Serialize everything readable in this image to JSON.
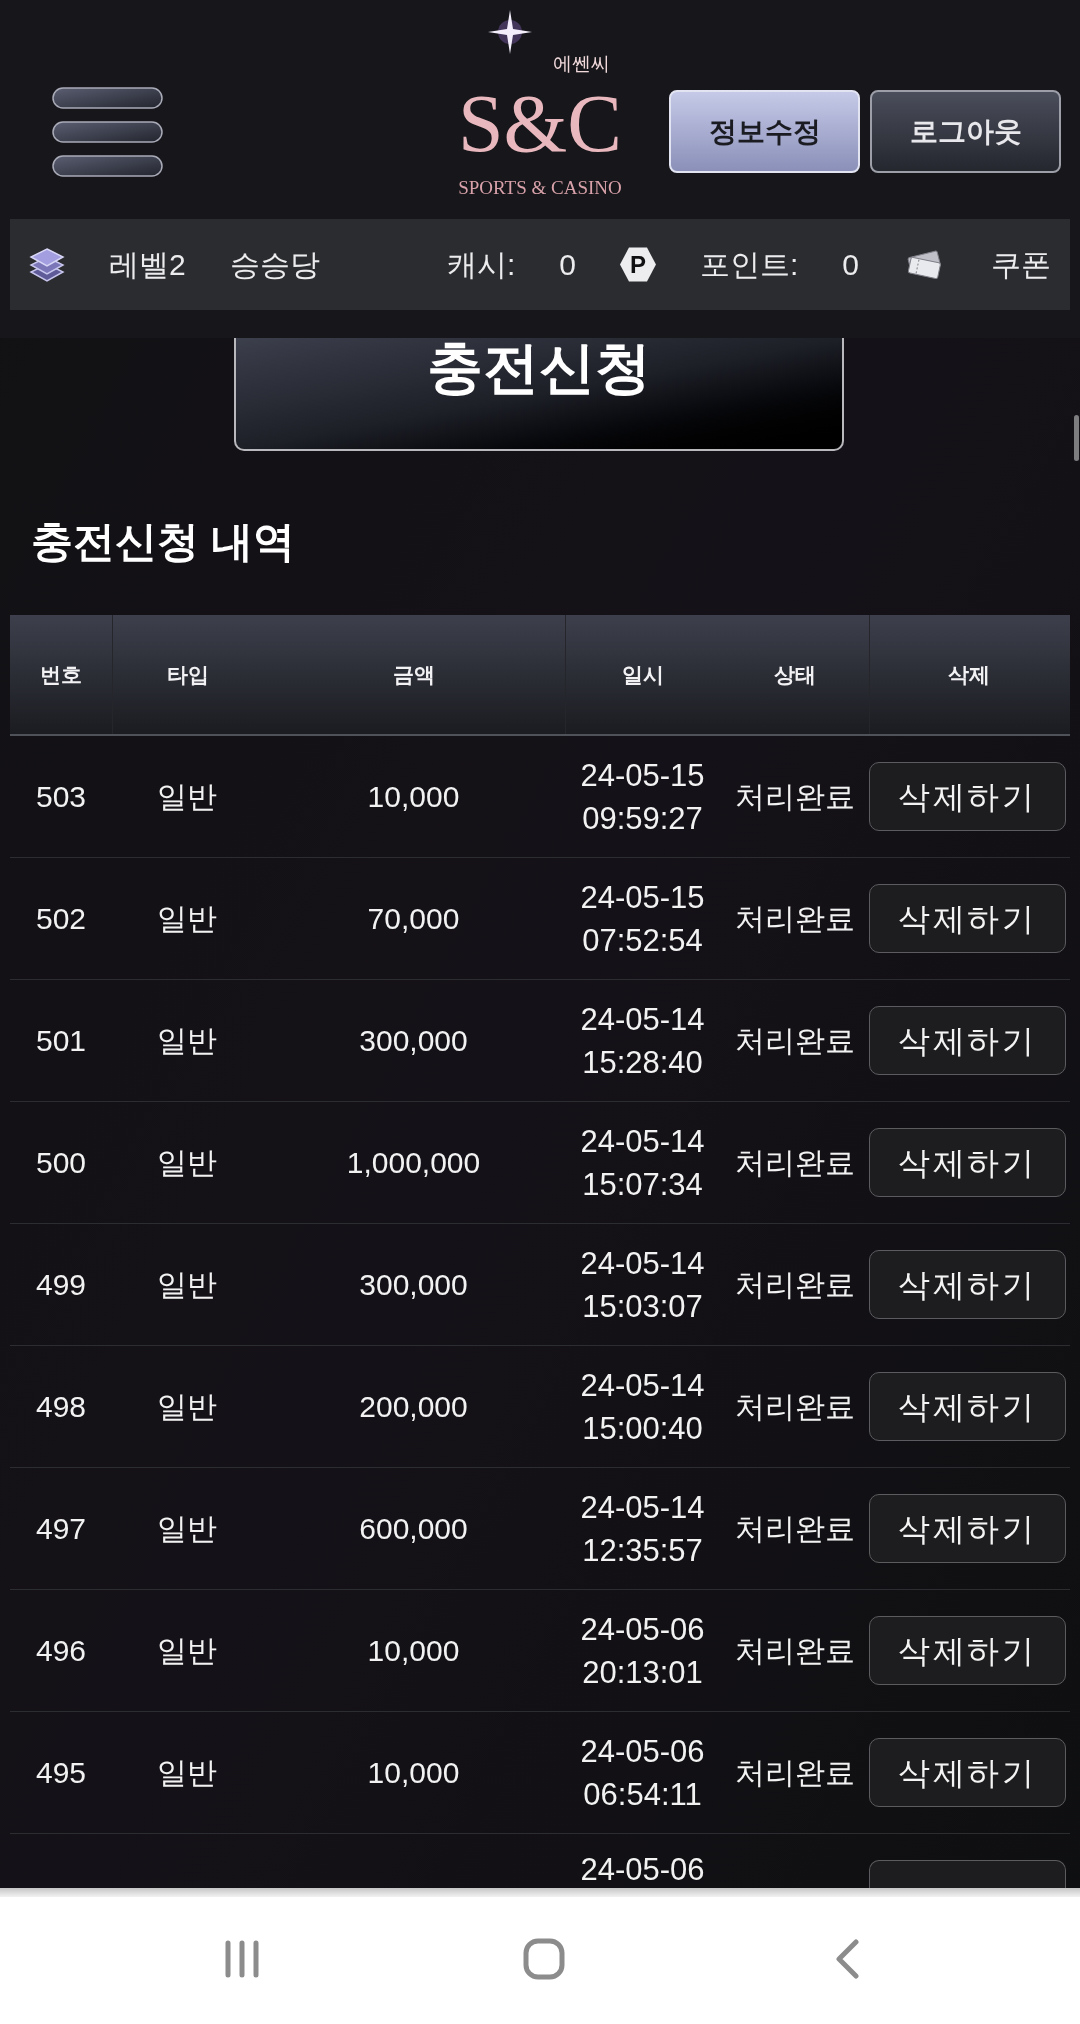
{
  "header": {
    "logo": {
      "korean": "에쎈씨",
      "mark": "S&C",
      "tagline": "SPORTS & CASINO"
    },
    "buttons": [
      {
        "label": "정보수정",
        "kind": "primary"
      },
      {
        "label": "로그아웃",
        "kind": "secondary"
      }
    ]
  },
  "info_bar": {
    "level": "레벨2",
    "username": "승승당",
    "cash_label": "캐시:",
    "cash": "0",
    "points_badge": "P",
    "points_label": "포인트:",
    "points": "0",
    "coupon": "쿠폰"
  },
  "charge_button": "충전신청",
  "history": {
    "title": "충전신청 내역",
    "columns": [
      "번호",
      "타입",
      "금액",
      "일시",
      "상태",
      "삭제"
    ],
    "rows": [
      {
        "kind": "full",
        "no": "503",
        "type": "일반",
        "amount": "10,000",
        "date": "24-05-15",
        "time": "09:59:27",
        "status": "처리완료",
        "action": "삭제하기"
      },
      {
        "kind": "full",
        "no": "502",
        "type": "일반",
        "amount": "70,000",
        "date": "24-05-15",
        "time": "07:52:54",
        "status": "처리완료",
        "action": "삭제하기"
      },
      {
        "kind": "full",
        "no": "501",
        "type": "일반",
        "amount": "300,000",
        "date": "24-05-14",
        "time": "15:28:40",
        "status": "처리완료",
        "action": "삭제하기"
      },
      {
        "kind": "full",
        "no": "500",
        "type": "일반",
        "amount": "1,000,000",
        "date": "24-05-14",
        "time": "15:07:34",
        "status": "처리완료",
        "action": "삭제하기"
      },
      {
        "kind": "full",
        "no": "499",
        "type": "일반",
        "amount": "300,000",
        "date": "24-05-14",
        "time": "15:03:07",
        "status": "처리완료",
        "action": "삭제하기"
      },
      {
        "kind": "full",
        "no": "498",
        "type": "일반",
        "amount": "200,000",
        "date": "24-05-14",
        "time": "15:00:40",
        "status": "처리완료",
        "action": "삭제하기"
      },
      {
        "kind": "full",
        "no": "497",
        "type": "일반",
        "amount": "600,000",
        "date": "24-05-14",
        "time": "12:35:57",
        "status": "처리완료",
        "action": "삭제하기"
      },
      {
        "kind": "full",
        "no": "496",
        "type": "일반",
        "amount": "10,000",
        "date": "24-05-06",
        "time": "20:13:01",
        "status": "처리완료",
        "action": "삭제하기"
      },
      {
        "kind": "full",
        "no": "495",
        "type": "일반",
        "amount": "10,000",
        "date": "24-05-06",
        "time": "06:54:11",
        "status": "처리완료",
        "action": "삭제하기"
      },
      {
        "kind": "cut",
        "date": "24-05-06"
      }
    ]
  }
}
